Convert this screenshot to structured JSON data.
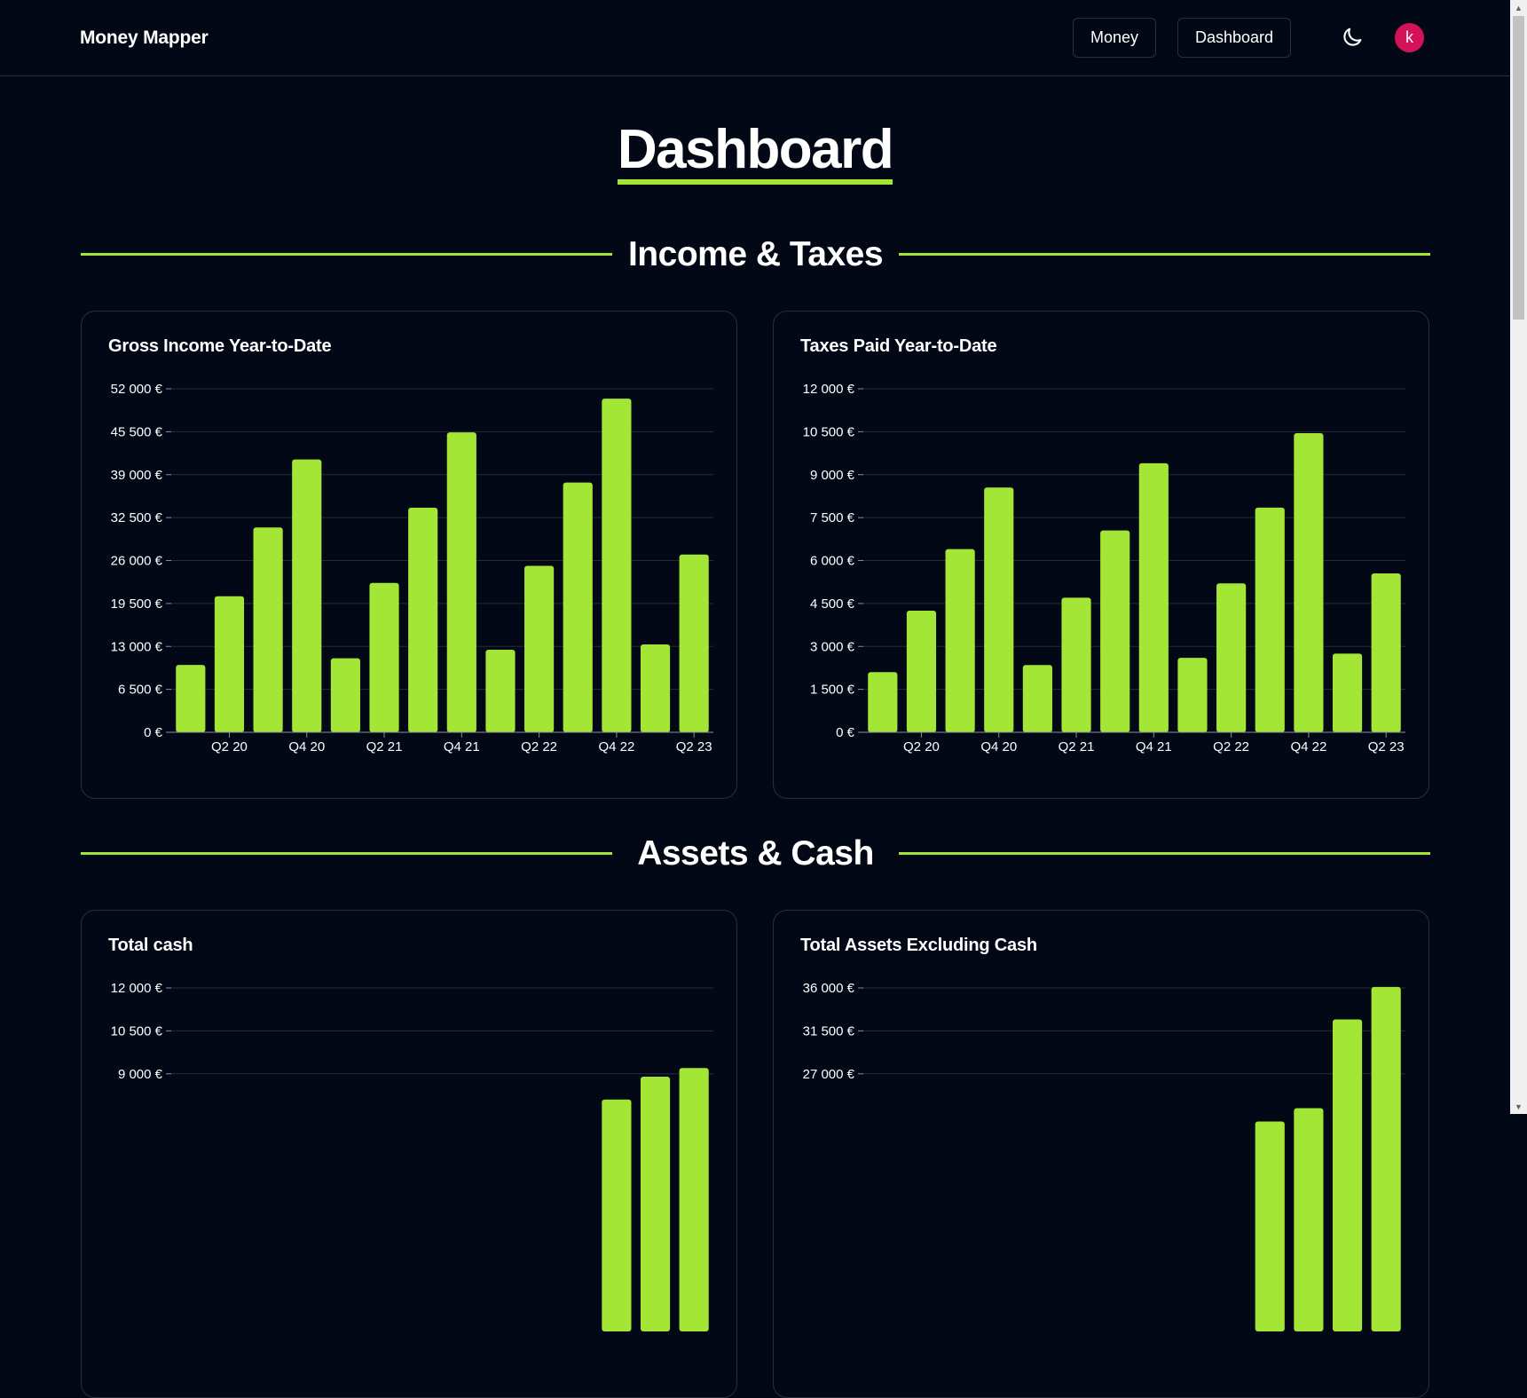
{
  "app": {
    "brand": "Money Mapper",
    "nav": [
      "Money",
      "Dashboard"
    ],
    "avatar_initial": "k",
    "theme_icon": "moon-icon"
  },
  "colors": {
    "background": "#030816",
    "accent": "#a3e635",
    "avatar": "#d31259",
    "border": "#2a2f3c"
  },
  "page": {
    "title": "Dashboard"
  },
  "sections": [
    {
      "title": "Income & Taxes"
    },
    {
      "title": "Assets & Cash"
    }
  ],
  "chart_data": [
    {
      "title": "Gross Income Year-to-Date",
      "type": "bar",
      "categories": [
        "Q1 20",
        "Q2 20",
        "Q3 20",
        "Q4 20",
        "Q1 21",
        "Q2 21",
        "Q3 21",
        "Q4 21",
        "Q1 22",
        "Q2 22",
        "Q3 22",
        "Q4 22",
        "Q1 23",
        "Q2 23"
      ],
      "x_tick_labels": [
        "Q2 20",
        "Q4 20",
        "Q2 21",
        "Q4 21",
        "Q2 22",
        "Q4 22",
        "Q2 23"
      ],
      "y_ticks": [
        "0 €",
        "6 500 €",
        "13 000 €",
        "19 500 €",
        "26 000 €",
        "32 500 €",
        "39 000 €",
        "45 500 €",
        "52 000 €"
      ],
      "values": [
        10200,
        20600,
        31000,
        41300,
        11200,
        22600,
        34000,
        45400,
        12500,
        25200,
        37800,
        50500,
        13300,
        26900
      ],
      "ylim": [
        0,
        52000
      ],
      "grid": true,
      "xlabel": "",
      "ylabel": ""
    },
    {
      "title": "Taxes Paid Year-to-Date",
      "type": "bar",
      "categories": [
        "Q1 20",
        "Q2 20",
        "Q3 20",
        "Q4 20",
        "Q1 21",
        "Q2 21",
        "Q3 21",
        "Q4 21",
        "Q1 22",
        "Q2 22",
        "Q3 22",
        "Q4 22",
        "Q1 23",
        "Q2 23"
      ],
      "x_tick_labels": [
        "Q2 20",
        "Q4 20",
        "Q2 21",
        "Q4 21",
        "Q2 22",
        "Q4 22",
        "Q2 23"
      ],
      "y_ticks": [
        "0 €",
        "1 500 €",
        "3 000 €",
        "4 500 €",
        "6 000 €",
        "7 500 €",
        "9 000 €",
        "10 500 €",
        "12 000 €"
      ],
      "values": [
        2100,
        4250,
        6400,
        8550,
        2350,
        4700,
        7050,
        9400,
        2600,
        5200,
        7850,
        10450,
        2750,
        5550
      ],
      "ylim": [
        0,
        12000
      ],
      "grid": true,
      "xlabel": "",
      "ylabel": ""
    },
    {
      "title": "Total cash",
      "type": "bar",
      "categories": [
        "Q1 20",
        "Q2 20",
        "Q3 20",
        "Q4 20",
        "Q1 21",
        "Q2 21",
        "Q3 21",
        "Q4 21",
        "Q1 22",
        "Q2 22",
        "Q3 22",
        "Q4 22",
        "Q1 23",
        "Q2 23"
      ],
      "y_ticks": [
        "9 000 €",
        "10 500 €",
        "12 000 €"
      ],
      "values": [
        null,
        null,
        null,
        null,
        null,
        null,
        null,
        null,
        null,
        null,
        null,
        8100,
        8900,
        9200
      ],
      "ylim": [
        0,
        12000
      ],
      "grid": true,
      "xlabel": "",
      "ylabel": ""
    },
    {
      "title": "Total Assets Excluding Cash",
      "type": "bar",
      "categories": [
        "Q1 20",
        "Q2 20",
        "Q3 20",
        "Q4 20",
        "Q1 21",
        "Q2 21",
        "Q3 21",
        "Q4 21",
        "Q1 22",
        "Q2 22",
        "Q3 22",
        "Q4 22",
        "Q1 23",
        "Q2 23"
      ],
      "y_ticks": [
        "27 000 €",
        "31 500 €",
        "36 000 €"
      ],
      "values": [
        null,
        null,
        null,
        null,
        null,
        null,
        null,
        null,
        null,
        null,
        22000,
        23400,
        32700,
        36100
      ],
      "ylim": [
        0,
        36000
      ],
      "grid": true,
      "xlabel": "",
      "ylabel": ""
    }
  ]
}
